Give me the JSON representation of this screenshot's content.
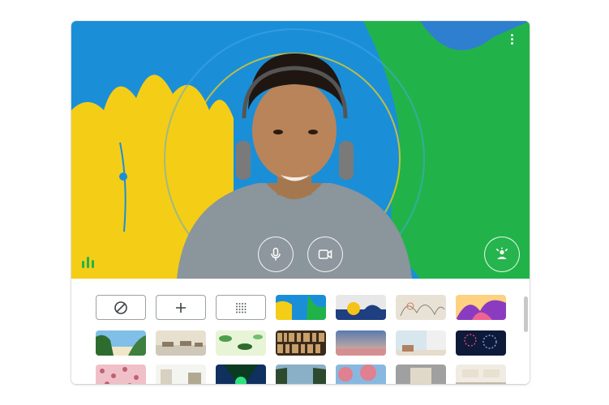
{
  "preview": {
    "icons": {
      "more": "more-vert-icon",
      "mic": "microphone-icon",
      "camera": "video-camera-icon",
      "background": "person-background-icon",
      "audio": "audio-level-icon"
    },
    "colors": {
      "sky_blue": "#1a8fd8",
      "yellow": "#f4cd17",
      "green": "#21b34a",
      "shirt": "#8b959c"
    }
  },
  "background_panel": {
    "options": [
      {
        "name": "no-effect",
        "icon": "no-effect-icon"
      },
      {
        "name": "upload-background",
        "icon": "plus-icon"
      },
      {
        "name": "blur-background",
        "icon": "blur-icon"
      }
    ],
    "tiles": [
      {
        "name": "colorful-waves",
        "colors": [
          "#f4cd17",
          "#1a8fd8",
          "#21b34a"
        ]
      },
      {
        "name": "abstract-shapes",
        "colors": [
          "#1e3f80",
          "#f5c21a",
          "#e8e8e8"
        ]
      },
      {
        "name": "line-art",
        "colors": [
          "#e8e2d6",
          "#b9b2a4",
          "#d97a5b"
        ]
      },
      {
        "name": "purple-leaves",
        "colors": [
          "#8b3bbf",
          "#f06292",
          "#ffd180"
        ]
      },
      {
        "name": "tropical-beach",
        "colors": [
          "#7fbfe8",
          "#2e6b2e",
          "#f0e6c8"
        ]
      },
      {
        "name": "zebras",
        "colors": [
          "#cfc7b8",
          "#8a7a62",
          "#e8e0cf"
        ]
      },
      {
        "name": "green-pattern",
        "colors": [
          "#e8f4d6",
          "#4f9e4f",
          "#2e6b2e"
        ]
      },
      {
        "name": "bookshelf",
        "colors": [
          "#6b4a2e",
          "#c8a06b",
          "#3b2a1a"
        ]
      },
      {
        "name": "sunset-sky",
        "colors": [
          "#5a7bb0",
          "#d49090",
          "#e8b8a0"
        ]
      },
      {
        "name": "interior-room",
        "colors": [
          "#d8e6ee",
          "#f0f0f0",
          "#b08060"
        ]
      },
      {
        "name": "fireworks",
        "colors": [
          "#0f1a3a",
          "#ff5080",
          "#80c0ff"
        ]
      },
      {
        "name": "pink-flowers",
        "colors": [
          "#f0c0c8",
          "#c06070",
          "#ffffff"
        ]
      },
      {
        "name": "white-room",
        "colors": [
          "#f4f4f0",
          "#d8d0c0",
          "#b0a890"
        ]
      },
      {
        "name": "green-lights",
        "colors": [
          "#0a3a20",
          "#30e080",
          "#103060"
        ]
      },
      {
        "name": "forest",
        "colors": [
          "#2e4a2e",
          "#8ab0c8",
          "#5a7a3a"
        ]
      },
      {
        "name": "cherry-blossom",
        "colors": [
          "#e08090",
          "#88b8e0",
          "#4a8a4a"
        ]
      },
      {
        "name": "modern-room",
        "colors": [
          "#5a5a5a",
          "#e0d8c8",
          "#a0a0a0"
        ]
      },
      {
        "name": "bright-kitchen",
        "colors": [
          "#f0ece4",
          "#c0b8a8",
          "#e8e0d0"
        ]
      }
    ]
  }
}
